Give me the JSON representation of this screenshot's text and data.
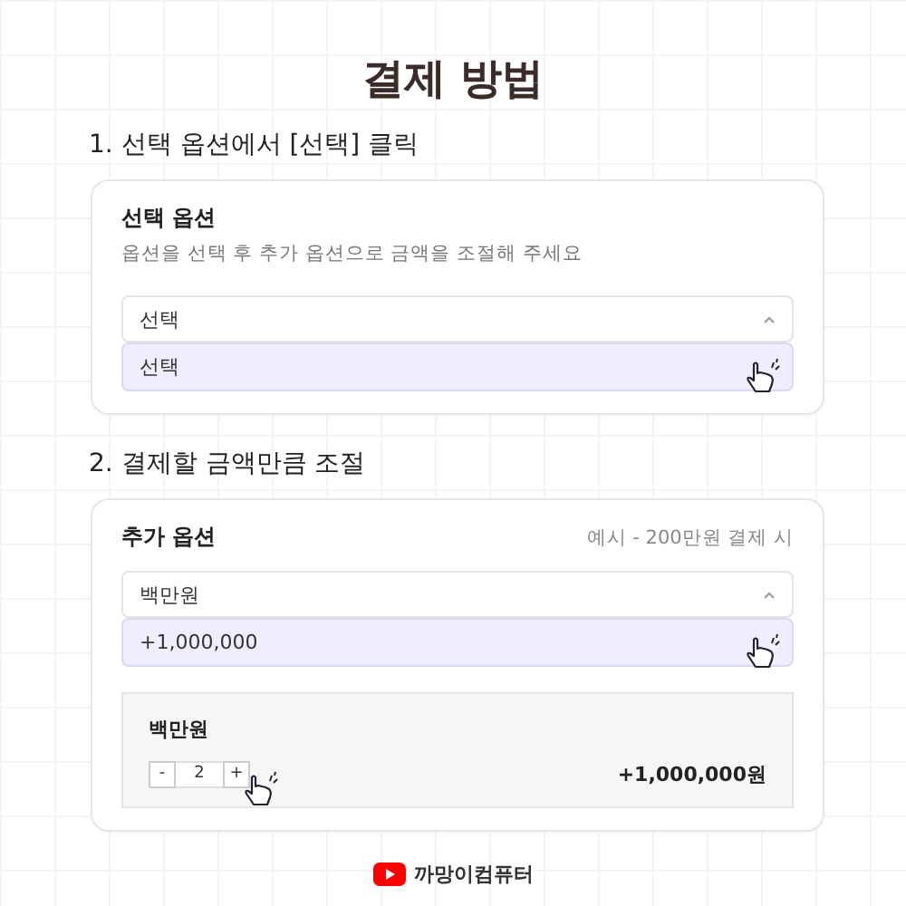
{
  "title": "결제 방법",
  "step1": {
    "heading": "1. 선택 옵션에서 [선택] 클릭",
    "card": {
      "title": "선택 옵션",
      "description": "옵션을 선택 후 추가 옵션으로 금액을 조절해 주세요",
      "select": {
        "value": "선택",
        "expanded": true
      },
      "options": [
        {
          "label": "선택",
          "selected": true
        }
      ]
    }
  },
  "step2": {
    "heading": "2. 결제할 금액만큼 조절",
    "card": {
      "title": "추가 옵션",
      "note": "예시 - 200만원 결제 시",
      "select": {
        "value": "백만원",
        "expanded": true
      },
      "options": [
        {
          "label": "+1,000,000",
          "selected": true
        }
      ],
      "item": {
        "name": "백만원",
        "minus": "-",
        "quantity": "2",
        "plus": "+",
        "price": "+1,000,000원"
      }
    }
  },
  "footer": {
    "channel": "까망이컴퓨터"
  }
}
